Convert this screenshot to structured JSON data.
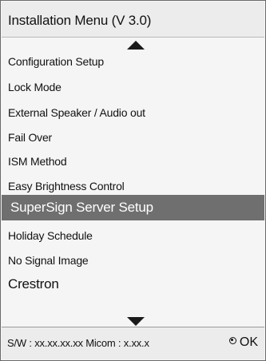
{
  "menu": {
    "title": "Installation Menu (V 3.0)",
    "items": [
      {
        "label": "Configuration Setup",
        "selected": false
      },
      {
        "label": "Lock Mode",
        "selected": false
      },
      {
        "label": "External Speaker / Audio out",
        "selected": false
      },
      {
        "label": "Fail Over",
        "selected": false
      },
      {
        "label": "ISM Method",
        "selected": false
      },
      {
        "label": "Easy Brightness Control",
        "selected": false
      },
      {
        "label": "SuperSign Server Setup",
        "selected": true
      },
      {
        "label": "Holiday Schedule",
        "selected": false
      },
      {
        "label": "No Signal Image",
        "selected": false
      },
      {
        "label": "Crestron",
        "selected": false
      }
    ],
    "scroll_up_icon": "triangle-up-icon",
    "scroll_down_icon": "triangle-down-icon"
  },
  "footer": {
    "info": "S/W : xx.xx.xx.xx Micom : x.xx.x",
    "ok_icon": "ok-button-icon",
    "ok_label": "OK"
  },
  "colors": {
    "selected_bg": "#6f6f6f",
    "selected_text": "#ffffff",
    "panel_bg": "#f5f5f5"
  }
}
